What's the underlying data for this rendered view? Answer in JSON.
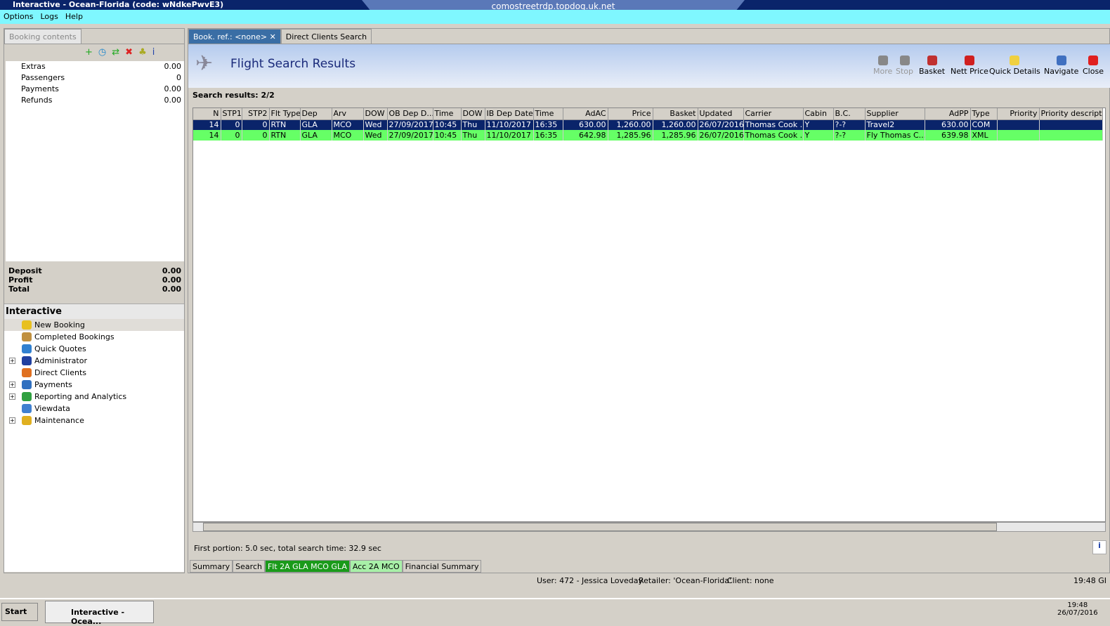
{
  "window": {
    "title": "Interactive - Ocean-Florida (code: wNdkePwvE3)",
    "rdp_host": "comostreetrdp.topdog.uk.net"
  },
  "menu": [
    "Options",
    "Logs",
    "Help"
  ],
  "booking": {
    "tab_label": "Booking contents",
    "rows": [
      {
        "label": "Extras",
        "value": "0.00"
      },
      {
        "label": "Passengers",
        "value": "0"
      },
      {
        "label": "Payments",
        "value": "0.00"
      },
      {
        "label": "Refunds",
        "value": "0.00"
      }
    ],
    "totals": [
      {
        "label": "Deposit",
        "value": "0.00"
      },
      {
        "label": "Profit",
        "value": "0.00"
      },
      {
        "label": "Total",
        "value": "0.00"
      }
    ]
  },
  "interactive": {
    "title": "Interactive",
    "items": [
      {
        "label": "New Booking",
        "expand": false,
        "color": "#e8c020"
      },
      {
        "label": "Completed Bookings",
        "expand": false,
        "color": "#c09040"
      },
      {
        "label": "Quick Quotes",
        "expand": false,
        "color": "#3080d0"
      },
      {
        "label": "Administrator",
        "expand": true,
        "color": "#2040a0"
      },
      {
        "label": "Direct Clients",
        "expand": false,
        "color": "#e07020"
      },
      {
        "label": "Payments",
        "expand": true,
        "color": "#3070c0"
      },
      {
        "label": "Reporting and Analytics",
        "expand": true,
        "color": "#30a040"
      },
      {
        "label": "Viewdata",
        "expand": false,
        "color": "#4080d0"
      },
      {
        "label": "Maintenance",
        "expand": true,
        "color": "#e0b020"
      }
    ]
  },
  "tabs": [
    {
      "label": "Book. ref.: <none>"
    },
    {
      "label": "Direct Clients Search"
    }
  ],
  "header": {
    "title": "Flight Search Results"
  },
  "toolbar": [
    {
      "label": "More",
      "color": "#888",
      "disabled": true
    },
    {
      "label": "Stop",
      "color": "#888",
      "disabled": true
    },
    {
      "label": "Basket",
      "color": "#c03030"
    },
    {
      "label": "Nett Price",
      "color": "#d02020"
    },
    {
      "label": "Quick Details",
      "color": "#f0d040"
    },
    {
      "label": "Navigate",
      "color": "#4070c0"
    },
    {
      "label": "Close",
      "color": "#e02020"
    }
  ],
  "results_label": "Search results: 2/2",
  "columns": [
    {
      "name": "N",
      "num": true
    },
    {
      "name": "STP1",
      "num": true
    },
    {
      "name": "STP2",
      "num": true
    },
    {
      "name": "Flt Type"
    },
    {
      "name": "Dep"
    },
    {
      "name": "Arv"
    },
    {
      "name": "DOW"
    },
    {
      "name": "OB Dep D..."
    },
    {
      "name": "Time"
    },
    {
      "name": "DOW"
    },
    {
      "name": "IB Dep Date"
    },
    {
      "name": "Time"
    },
    {
      "name": "AdAC",
      "num": true
    },
    {
      "name": "Price",
      "num": true
    },
    {
      "name": "Basket",
      "num": true
    },
    {
      "name": "Updated"
    },
    {
      "name": "Carrier"
    },
    {
      "name": "Cabin"
    },
    {
      "name": "B.C."
    },
    {
      "name": "Supplier"
    },
    {
      "name": "AdPP",
      "num": true
    },
    {
      "name": "Type"
    },
    {
      "name": "Priority",
      "num": true
    },
    {
      "name": "Priority description"
    }
  ],
  "rows": [
    [
      "14",
      "0",
      "0",
      "RTN",
      "GLA",
      "MCO",
      "Wed",
      "27/09/2017",
      "10:45",
      "Thu",
      "11/10/2017",
      "16:35",
      "630.00",
      "1,260.00",
      "1,260.00",
      "26/07/2016",
      "Thomas Cook ...",
      "Y",
      "?-?",
      "Travel2",
      "630.00",
      "COM",
      "",
      ""
    ],
    [
      "14",
      "0",
      "0",
      "RTN",
      "GLA",
      "MCO",
      "Wed",
      "27/09/2017",
      "10:45",
      "Thu",
      "11/10/2017",
      "16:35",
      "642.98",
      "1,285.96",
      "1,285.96",
      "26/07/2016",
      "Thomas Cook ...",
      "Y",
      "?-?",
      "Fly Thomas C...",
      "639.98",
      "XML",
      "",
      ""
    ]
  ],
  "timing": "First portion: 5.0 sec, total search time: 32.9 sec",
  "bottom_tabs": [
    {
      "label": "Summary",
      "bg": "#d4d0c8",
      "fg": "#000"
    },
    {
      "label": "Search",
      "bg": "#d4d0c8",
      "fg": "#000"
    },
    {
      "label": "Flt 2A GLA MCO GLA",
      "bg": "#1a9a1a",
      "fg": "#fff"
    },
    {
      "label": "Acc 2A MCO",
      "bg": "#a8f0a8",
      "fg": "#000"
    },
    {
      "label": "Financial Summary",
      "bg": "#d4d0c8",
      "fg": "#000"
    }
  ],
  "status": {
    "user": "User: 472 - Jessica Loveday",
    "retailer": "Retailer: 'Ocean-Florida'",
    "client": "Client: none",
    "time": "19:48 GI"
  },
  "taskbar": {
    "start": "Start",
    "app": "Interactive - Ocea...",
    "clock_time": "19:48",
    "clock_date": "26/07/2016"
  }
}
